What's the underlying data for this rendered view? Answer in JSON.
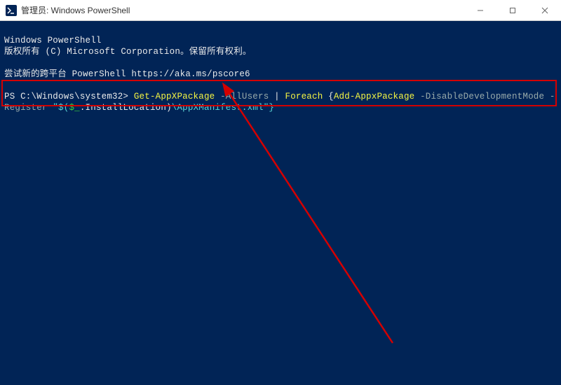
{
  "titlebar": {
    "title": "管理员: Windows PowerShell"
  },
  "terminal": {
    "line1": "Windows PowerShell",
    "line2": "版权所有 (C) Microsoft Corporation。保留所有权利。",
    "line3": "尝试新的跨平台 PowerShell https://aka.ms/pscore6",
    "prompt_path": "PS C:\\Windows\\system32>",
    "cmd_getpkg": "Get-AppXPackage",
    "flag_allusers": "-AllUsers",
    "pipe": " | ",
    "cmd_foreach": "Foreach",
    "brace_open": " {",
    "cmd_addpkg": "Add-AppxPackage",
    "flag_disable": "-DisableDevelopmentMode",
    "flag_register": "-Register",
    "tick_dq": " \"$(",
    "dollar_under": "$_",
    "dot": ".",
    "prop_ins": "Insta",
    "prop_loc": "llLocation",
    "closeparen": ")",
    "path_manifest": "\\AppXManifest.xml",
    "closing": "\"}"
  }
}
